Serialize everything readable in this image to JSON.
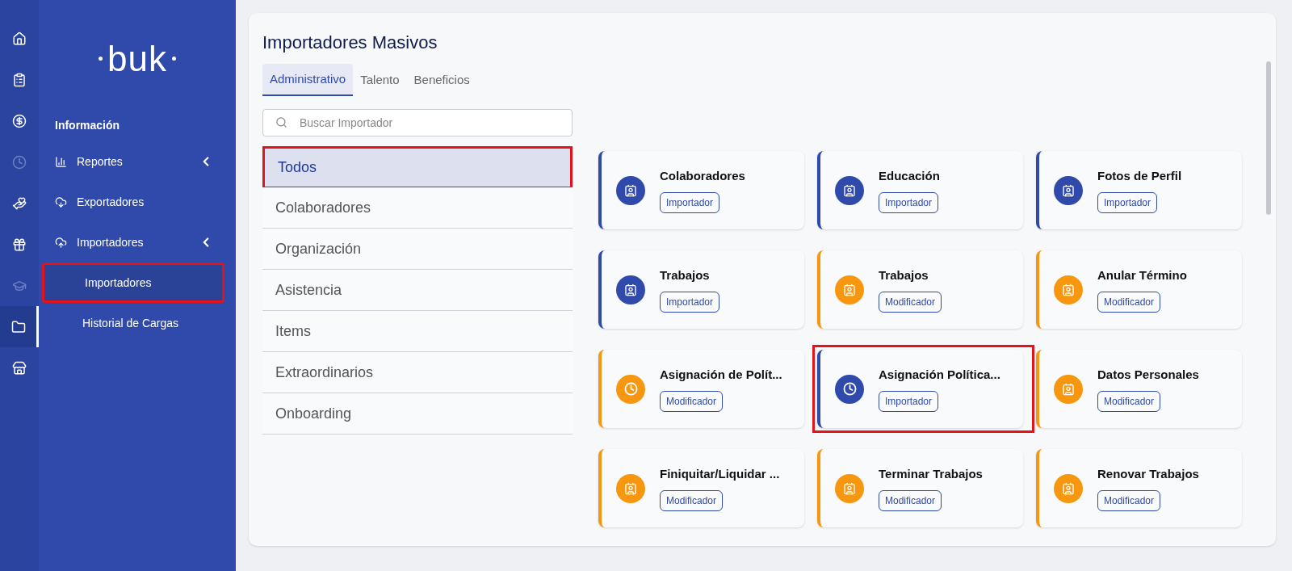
{
  "rail_items": [
    {
      "selected": false,
      "disabled": false
    },
    {
      "selected": false,
      "disabled": false
    },
    {
      "selected": false,
      "disabled": false
    },
    {
      "selected": false,
      "disabled": true
    },
    {
      "selected": false,
      "disabled": false
    },
    {
      "selected": false,
      "disabled": false
    },
    {
      "selected": false,
      "disabled": true
    },
    {
      "selected": true,
      "disabled": false
    },
    {
      "selected": false,
      "disabled": false
    }
  ],
  "logo": "buk",
  "nav": {
    "heading": "Información",
    "items": [
      {
        "label": "Reportes",
        "kind": "group"
      },
      {
        "label": "Exportadores",
        "kind": "link"
      },
      {
        "label": "Importadores",
        "kind": "group",
        "children": [
          {
            "label": "Importadores",
            "selected": true,
            "highlighted": true
          },
          {
            "label": "Historial de Cargas",
            "selected": false,
            "highlighted": false
          }
        ]
      }
    ]
  },
  "page": {
    "title": "Importadores Masivos",
    "tabs": [
      {
        "label": "Administrativo",
        "selected": true
      },
      {
        "label": "Talento",
        "selected": false
      },
      {
        "label": "Beneficios",
        "selected": false
      }
    ],
    "search": {
      "placeholder": "Buscar Importador"
    },
    "categories": [
      {
        "label": "Todos",
        "selected": true,
        "highlighted": true
      },
      {
        "label": "Colaboradores",
        "selected": false,
        "highlighted": false
      },
      {
        "label": "Organización",
        "selected": false,
        "highlighted": false
      },
      {
        "label": "Asistencia",
        "selected": false,
        "highlighted": false
      },
      {
        "label": "Items",
        "selected": false,
        "highlighted": false
      },
      {
        "label": "Extraordinarios",
        "selected": false,
        "highlighted": false
      },
      {
        "label": "Onboarding",
        "selected": false,
        "highlighted": false
      }
    ],
    "cards": [
      {
        "title": "Colaboradores",
        "badge": "Importador",
        "color": "#2f4aaa",
        "kind": "card",
        "highlighted": false
      },
      {
        "title": "Educación",
        "badge": "Importador",
        "color": "#2f4aaa",
        "kind": "card",
        "highlighted": false
      },
      {
        "title": "Fotos de Perfil",
        "badge": "Importador",
        "color": "#2f4aaa",
        "kind": "card",
        "highlighted": false
      },
      {
        "title": "Trabajos",
        "badge": "Importador",
        "color": "#2f4aaa",
        "kind": "card",
        "highlighted": false
      },
      {
        "title": "Trabajos",
        "badge": "Modificador",
        "color": "#f7960f",
        "kind": "card",
        "highlighted": false
      },
      {
        "title": "Anular Término",
        "badge": "Modificador",
        "color": "#f7960f",
        "kind": "card",
        "highlighted": false
      },
      {
        "title": "Asignación de Polít...",
        "badge": "Modificador",
        "color": "#f7960f",
        "kind": "clock",
        "highlighted": false
      },
      {
        "title": "Asignación Política...",
        "badge": "Importador",
        "color": "#2f4aaa",
        "kind": "clock",
        "highlighted": true
      },
      {
        "title": "Datos Personales",
        "badge": "Modificador",
        "color": "#f7960f",
        "kind": "card",
        "highlighted": false
      },
      {
        "title": "Finiquitar/Liquidar ...",
        "badge": "Modificador",
        "color": "#f7960f",
        "kind": "card",
        "highlighted": false
      },
      {
        "title": "Terminar Trabajos",
        "badge": "Modificador",
        "color": "#f7960f",
        "kind": "card",
        "highlighted": false
      },
      {
        "title": "Renovar Trabajos",
        "badge": "Modificador",
        "color": "#f7960f",
        "kind": "card",
        "highlighted": false
      }
    ]
  }
}
